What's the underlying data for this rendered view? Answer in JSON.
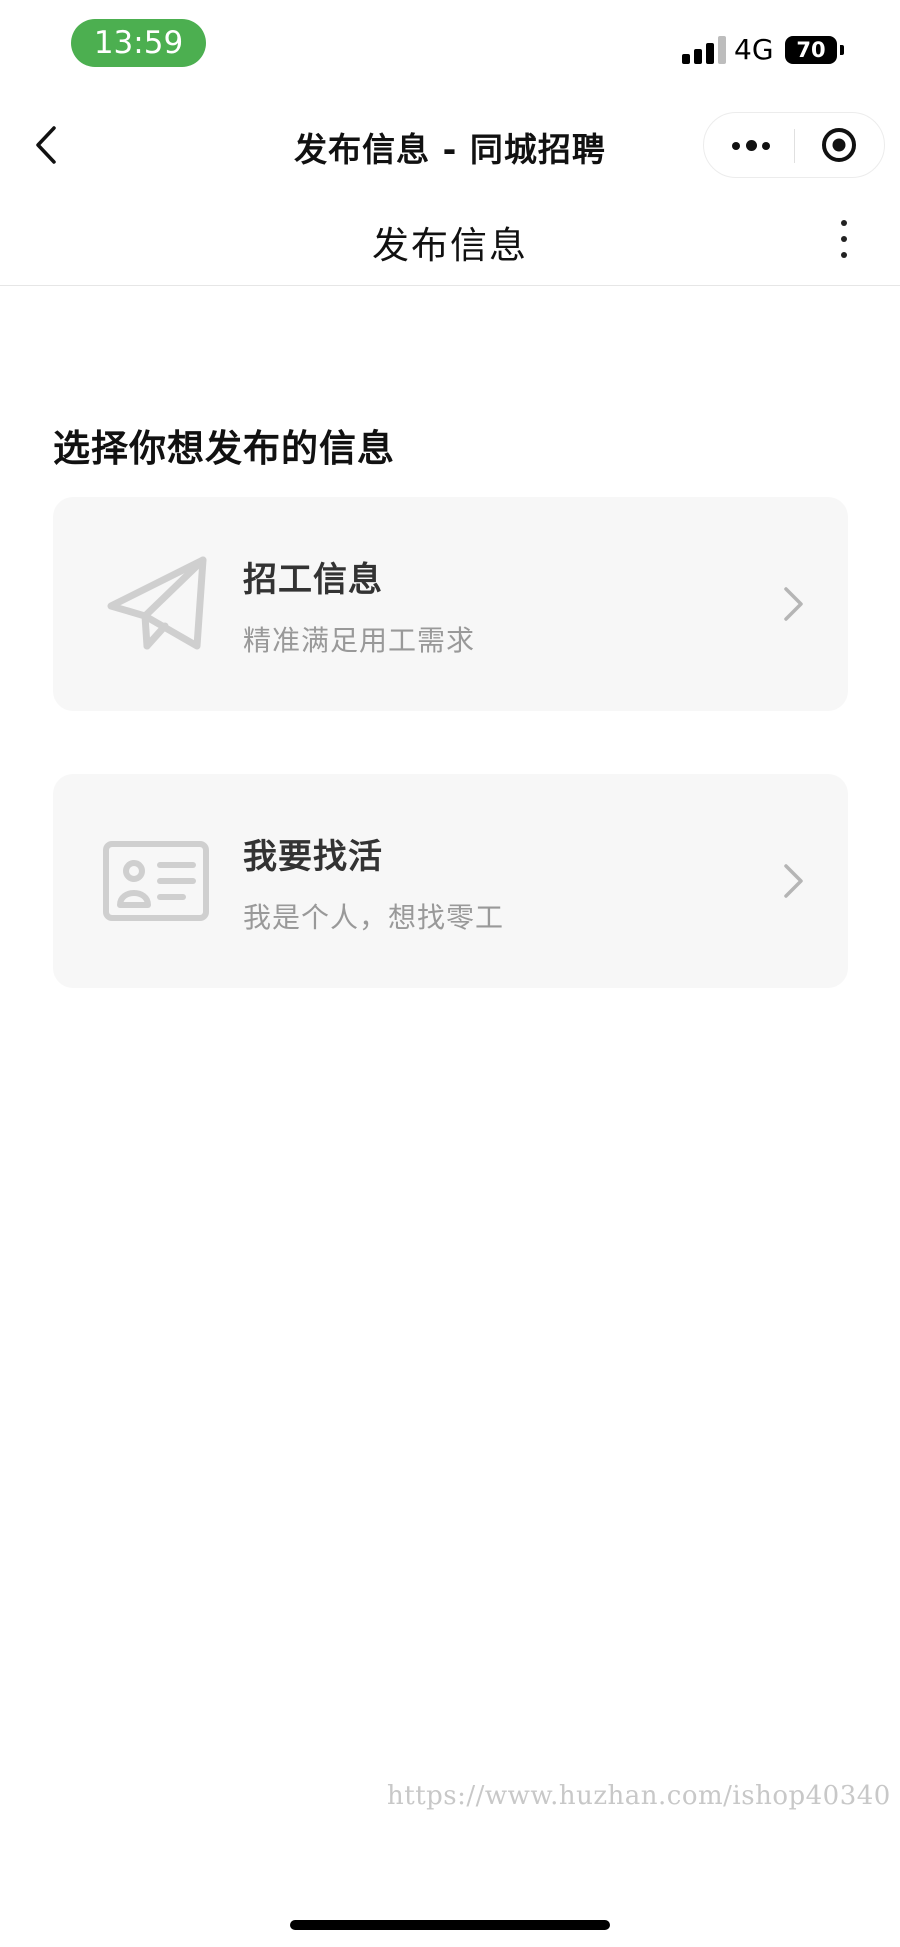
{
  "status_bar": {
    "time": "13:59",
    "network": "4G",
    "battery": "70"
  },
  "nav_bar": {
    "title": "发布信息 - 同城招聘"
  },
  "page_header": {
    "title": "发布信息"
  },
  "section": {
    "title": "选择你想发布的信息",
    "cards": [
      {
        "title": "招工信息",
        "subtitle": "精准满足用工需求",
        "icon": "paper-plane-icon"
      },
      {
        "title": "我要找活",
        "subtitle": "我是个人，想找零工",
        "icon": "id-card-icon"
      }
    ]
  },
  "watermark": "https://www.huzhan.com/ishop40340",
  "colors": {
    "time_pill": "#4caf50",
    "card_bg": "#f7f7f7",
    "icon_gray": "#cfcfcf",
    "subtitle_gray": "#999999"
  }
}
